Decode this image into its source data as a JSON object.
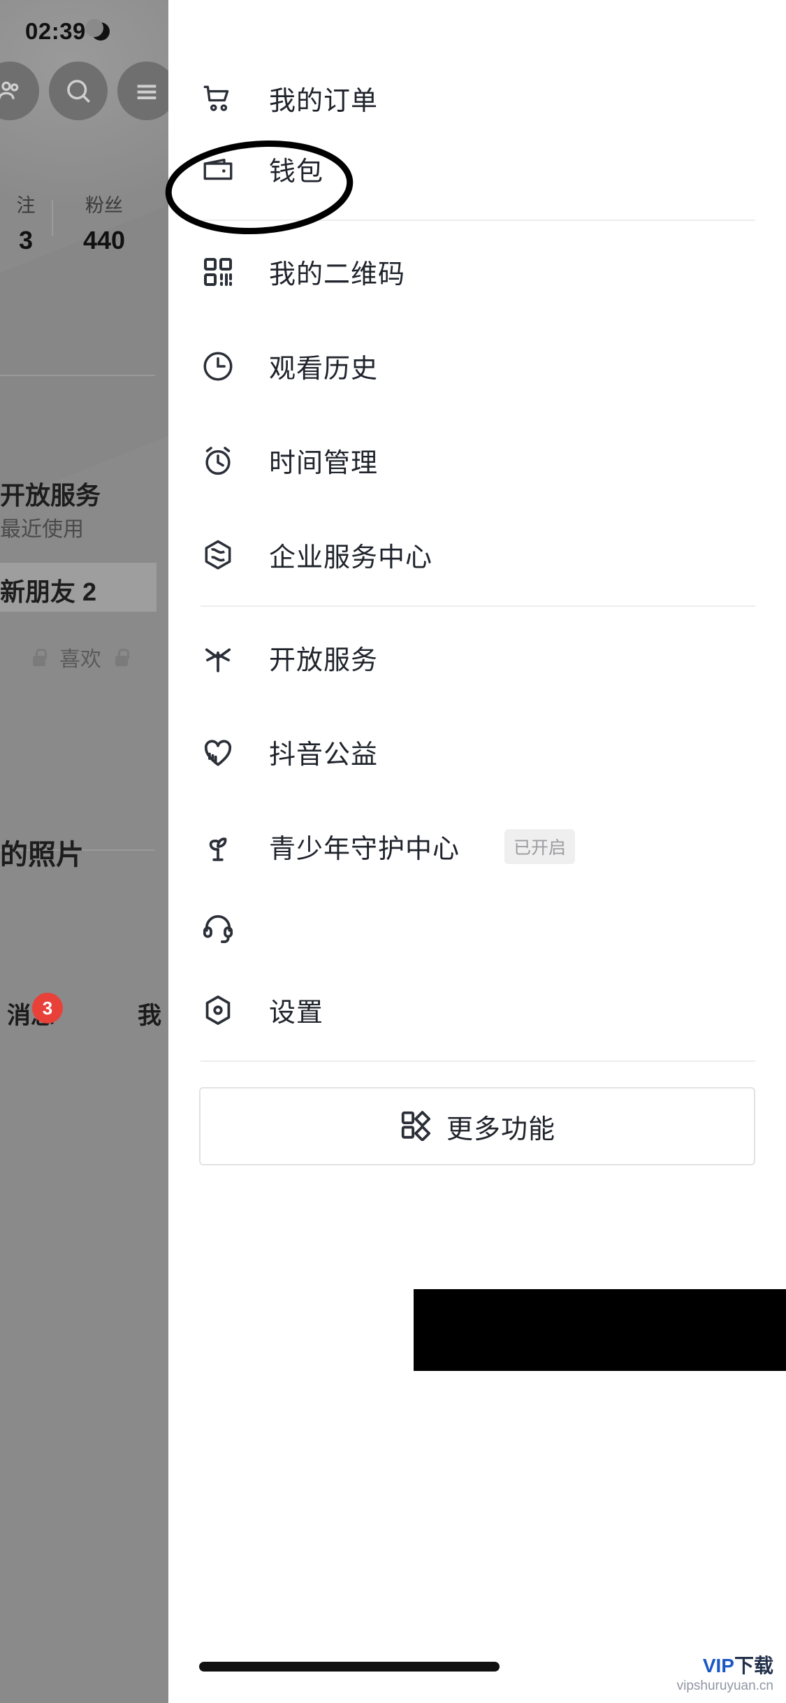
{
  "status_bar": {
    "time": "02:39",
    "moon_icon": "crescent-moon-icon",
    "signal_icon": "cellular-signal-icon",
    "wifi_icon": "wifi-icon",
    "battery_icon": "battery-charging-icon"
  },
  "backdrop": {
    "stats": [
      {
        "label": "注",
        "value": "3"
      },
      {
        "label": "粉丝",
        "value": "440"
      }
    ],
    "open_service": "开放服务",
    "recent_use": "最近使用",
    "new_friend": "新朋友 2",
    "like": "喜欢",
    "photos": "的照片",
    "tab_message": "消息",
    "tab_me": "我",
    "message_badge": "3"
  },
  "panel": {
    "groups": [
      {
        "items": [
          {
            "label": "我的订单",
            "icon": "shopping-cart-icon",
            "badge": ""
          },
          {
            "label": "钱包",
            "icon": "wallet-icon",
            "badge": ""
          }
        ]
      },
      {
        "items": [
          {
            "label": "我的二维码",
            "icon": "qr-code-icon",
            "badge": ""
          },
          {
            "label": "观看历史",
            "icon": "clock-icon",
            "badge": ""
          },
          {
            "label": "时间管理",
            "icon": "alarm-clock-icon",
            "badge": ""
          },
          {
            "label": "企业服务中心",
            "icon": "enterprise-cube-icon",
            "badge": ""
          }
        ]
      },
      {
        "items": [
          {
            "label": "开放服务",
            "icon": "asterisk-star-icon",
            "badge": ""
          },
          {
            "label": "抖音公益",
            "icon": "heart-charity-icon",
            "badge": ""
          },
          {
            "label": "青少年守护中心",
            "icon": "sprout-icon",
            "badge": "已开启"
          },
          {
            "label": "",
            "icon": "headset-icon",
            "badge": "",
            "redacted": true
          },
          {
            "label": "设置",
            "icon": "gear-hex-icon",
            "badge": ""
          }
        ]
      }
    ],
    "more_button": {
      "label": "更多功能",
      "icon": "grid-more-icon"
    }
  },
  "annotation": {
    "shape": "hand-drawn-ellipse",
    "target": "钱包",
    "color": "#000000"
  },
  "watermark": {
    "brand": "VIP下载",
    "site": "vipshuruyuan.cn"
  }
}
